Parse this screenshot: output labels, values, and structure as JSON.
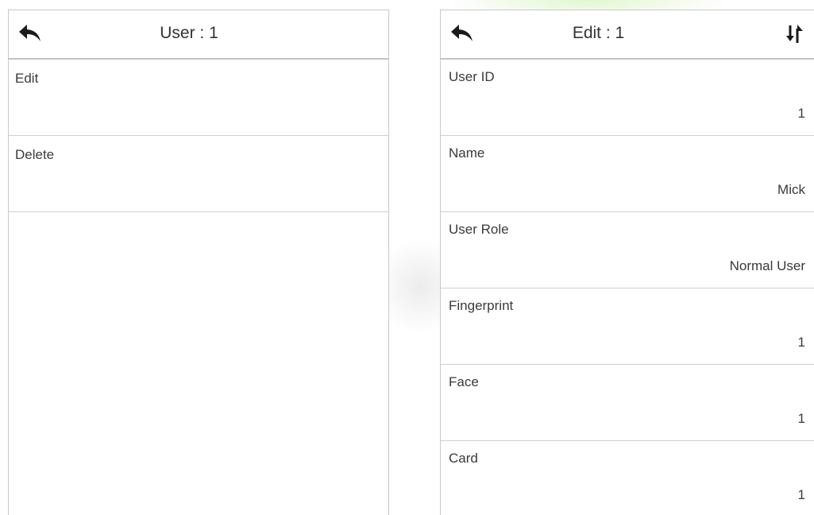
{
  "left_panel": {
    "title": "User : 1",
    "back_icon": "back-arrow-icon",
    "items": [
      {
        "label": "Edit"
      },
      {
        "label": "Delete"
      }
    ]
  },
  "right_panel": {
    "title": "Edit : 1",
    "back_icon": "back-arrow-icon",
    "sort_icon": "sort-arrows-icon",
    "fields": [
      {
        "label": "User ID",
        "value": "1"
      },
      {
        "label": "Name",
        "value": "Mick"
      },
      {
        "label": "User Role",
        "value": "Normal User"
      },
      {
        "label": "Fingerprint",
        "value": "1"
      },
      {
        "label": "Face",
        "value": "1"
      },
      {
        "label": "Card",
        "value": "1"
      }
    ]
  },
  "colors": {
    "border": "#c9c9c9",
    "text": "#3a3a3a",
    "icon": "#1a1a1a"
  }
}
